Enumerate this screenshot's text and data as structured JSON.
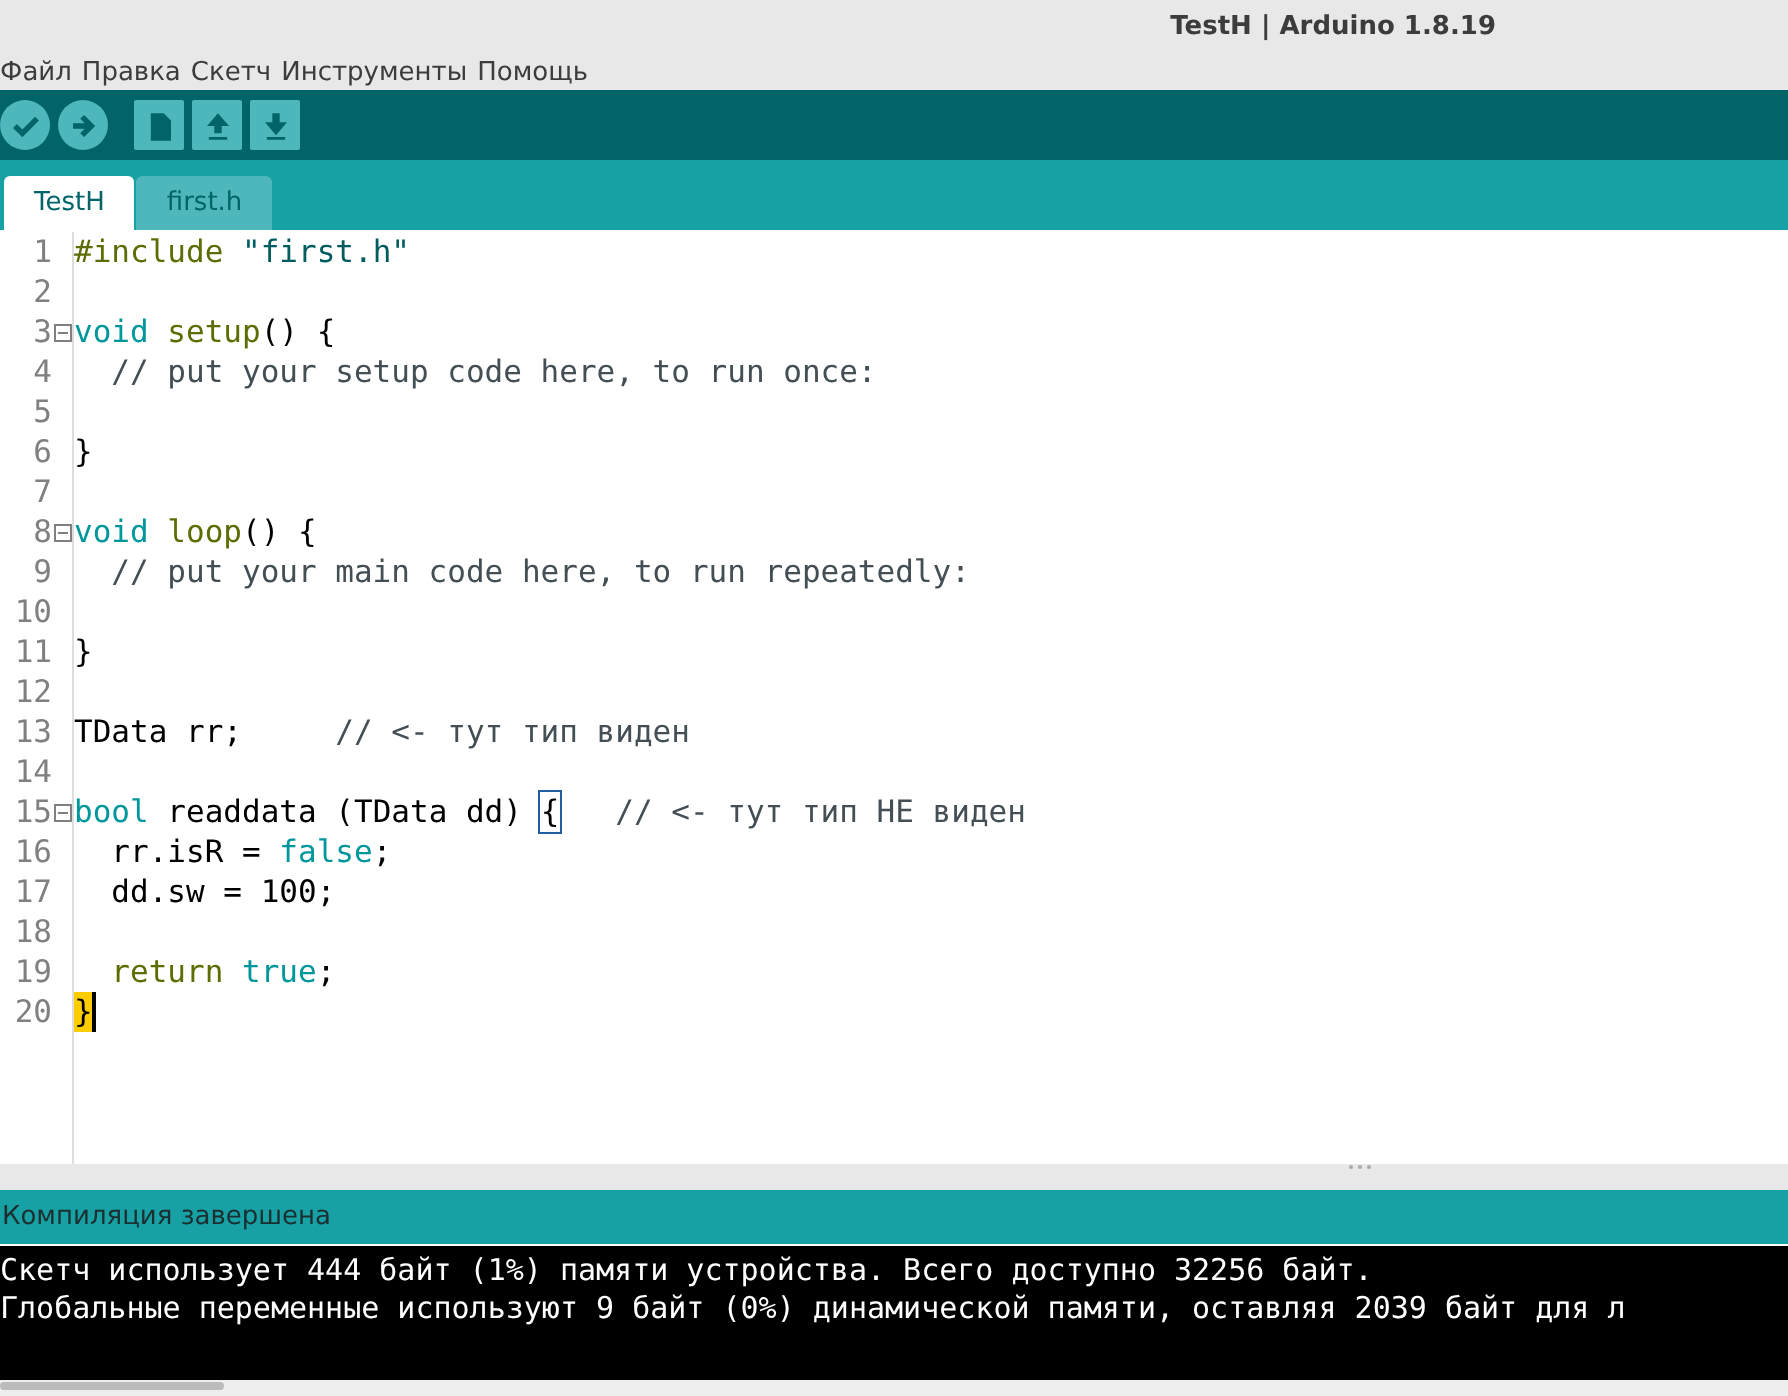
{
  "window": {
    "title": "TestH | Arduino 1.8.19"
  },
  "menu": [
    "Файл",
    "Правка",
    "Скетч",
    "Инструменты",
    "Помощь"
  ],
  "toolbar": [
    {
      "kind": "verify"
    },
    {
      "kind": "upload"
    },
    {
      "kind": "new"
    },
    {
      "kind": "open"
    },
    {
      "kind": "save"
    }
  ],
  "tabs": [
    {
      "label": "TestH",
      "selected": true
    },
    {
      "label": "first.h",
      "selected": false
    }
  ],
  "editor": {
    "lines": [
      {
        "number": "1",
        "fold": false,
        "tokens": [
          {
            "kind": "preproc",
            "text": "#include "
          },
          {
            "kind": "string",
            "text": "\"first.h\""
          }
        ]
      },
      {
        "number": "2",
        "fold": false
      },
      {
        "number": "3",
        "fold": true,
        "tokens": [
          {
            "kind": "keyword",
            "text": "void "
          },
          {
            "kind": "function",
            "text": "setup"
          },
          {
            "kind": "plain",
            "text": "() {"
          }
        ]
      },
      {
        "number": "4",
        "fold": false,
        "tokens": [
          {
            "kind": "comment",
            "text": "  // put your setup code here, to run once:"
          }
        ]
      },
      {
        "number": "5",
        "fold": false
      },
      {
        "number": "6",
        "fold": false,
        "tokens": [
          {
            "kind": "plain",
            "text": "}"
          }
        ]
      },
      {
        "number": "7",
        "fold": false
      },
      {
        "number": "8",
        "fold": true,
        "tokens": [
          {
            "kind": "keyword",
            "text": "void "
          },
          {
            "kind": "function",
            "text": "loop"
          },
          {
            "kind": "plain",
            "text": "() {"
          }
        ]
      },
      {
        "number": "9",
        "fold": false,
        "tokens": [
          {
            "kind": "comment",
            "text": "  // put your main code here, to run repeatedly:"
          }
        ]
      },
      {
        "number": "10",
        "fold": false
      },
      {
        "number": "11",
        "fold": false,
        "tokens": [
          {
            "kind": "plain",
            "text": "}"
          }
        ]
      },
      {
        "number": "12",
        "fold": false
      },
      {
        "number": "13",
        "fold": false,
        "tokens": [
          {
            "kind": "plain",
            "text": "TData rr;     "
          },
          {
            "kind": "comment",
            "text": "// <- тут тип виден"
          }
        ]
      },
      {
        "number": "14",
        "fold": false
      },
      {
        "number": "15",
        "fold": true,
        "tokens": [
          {
            "kind": "keyword",
            "text": "bool "
          },
          {
            "kind": "plain",
            "text": "readdata (TData dd) "
          },
          {
            "kind": "bracket-box",
            "text": "{"
          },
          {
            "kind": "comment",
            "text": "   // <- тут тип НЕ виден"
          }
        ]
      },
      {
        "number": "16",
        "fold": false,
        "tokens": [
          {
            "kind": "plain",
            "text": "  rr.isR = "
          },
          {
            "kind": "keyword",
            "text": "false"
          },
          {
            "kind": "plain",
            "text": ";"
          }
        ]
      },
      {
        "number": "17",
        "fold": false,
        "tokens": [
          {
            "kind": "plain",
            "text": "  dd.sw = 100;"
          }
        ]
      },
      {
        "number": "18",
        "fold": false
      },
      {
        "number": "19",
        "fold": false,
        "tokens": [
          {
            "kind": "function",
            "text": "  return "
          },
          {
            "kind": "keyword",
            "text": "true"
          },
          {
            "kind": "plain",
            "text": ";"
          }
        ]
      },
      {
        "number": "20",
        "fold": false,
        "tokens": [
          {
            "kind": "bracket-fill",
            "text": "}"
          }
        ]
      }
    ]
  },
  "status": "Компиляция завершена",
  "console": [
    "Скетч использует 444 байт (1%) памяти устройства. Всего доступно 32256 байт.",
    "Глобальные переменные используют 9 байт (0%) динамической памяти, оставляя 2039 байт для л"
  ]
}
